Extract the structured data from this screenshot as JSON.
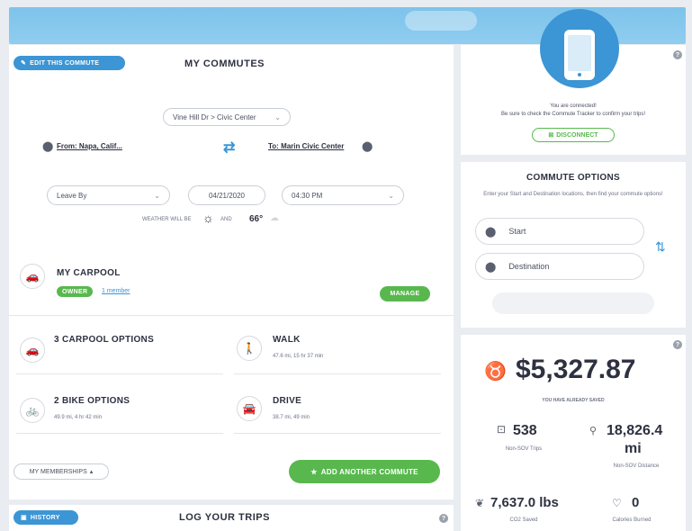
{
  "commutes": {
    "edit_button": "EDIT THIS COMMUTE",
    "title": "MY COMMUTES",
    "route_select": "Vine Hill Dr > Civic Center",
    "from_label": "From: Napa, Calif...",
    "to_label": "To: Marin Civic Center",
    "leave_by": "Leave By",
    "date": "04/21/2020",
    "time": "04:30 PM",
    "weather_prefix": "WEATHER WILL BE",
    "weather_and": "AND",
    "temperature": "66°"
  },
  "carpool": {
    "title": "MY CARPOOL",
    "owner_badge": "OWNER",
    "members_link": "1 member",
    "manage_button": "MANAGE"
  },
  "options": [
    {
      "title": "3 CARPOOL OPTIONS",
      "sub": ""
    },
    {
      "title": "WALK",
      "sub": "47.6 mi, 15 hr 37 min"
    },
    {
      "title": "2 BIKE OPTIONS",
      "sub": "49.9 mi, 4 hr 42 min"
    },
    {
      "title": "DRIVE",
      "sub": "38.7 mi, 49 min"
    }
  ],
  "footer": {
    "memberships": "MY MEMBERSHIPS",
    "add_commute": "ADD ANOTHER COMMUTE"
  },
  "history": {
    "button": "HISTORY",
    "title": "LOG YOUR TRIPS"
  },
  "connected": {
    "line1": "You are connected!",
    "line2": "Be sure to check the Commute Tracker to confirm your trips!",
    "disconnect": "DISCONNECT"
  },
  "commute_options": {
    "title": "COMMUTE OPTIONS",
    "desc": "Enter your Start and Destination locations, then find your commute options!",
    "start_placeholder": "Start",
    "dest_placeholder": "Destination"
  },
  "savings": {
    "amount": "$5,327.87",
    "amount_label": "YOU HAVE ALREADY SAVED",
    "trips": "538",
    "trips_label": "Non-SOV Trips",
    "distance": "18,826.4",
    "distance_unit": "mi",
    "distance_label": "Non-SOV Distance",
    "co2": "7,637.0 lbs",
    "co2_label": "CO2 Saved",
    "calories": "0",
    "calories_label": "Calories Burned"
  },
  "colors": {
    "accent_blue": "#3c95d4",
    "accent_green": "#58b84e",
    "header_sky": "#8fcdf0"
  }
}
